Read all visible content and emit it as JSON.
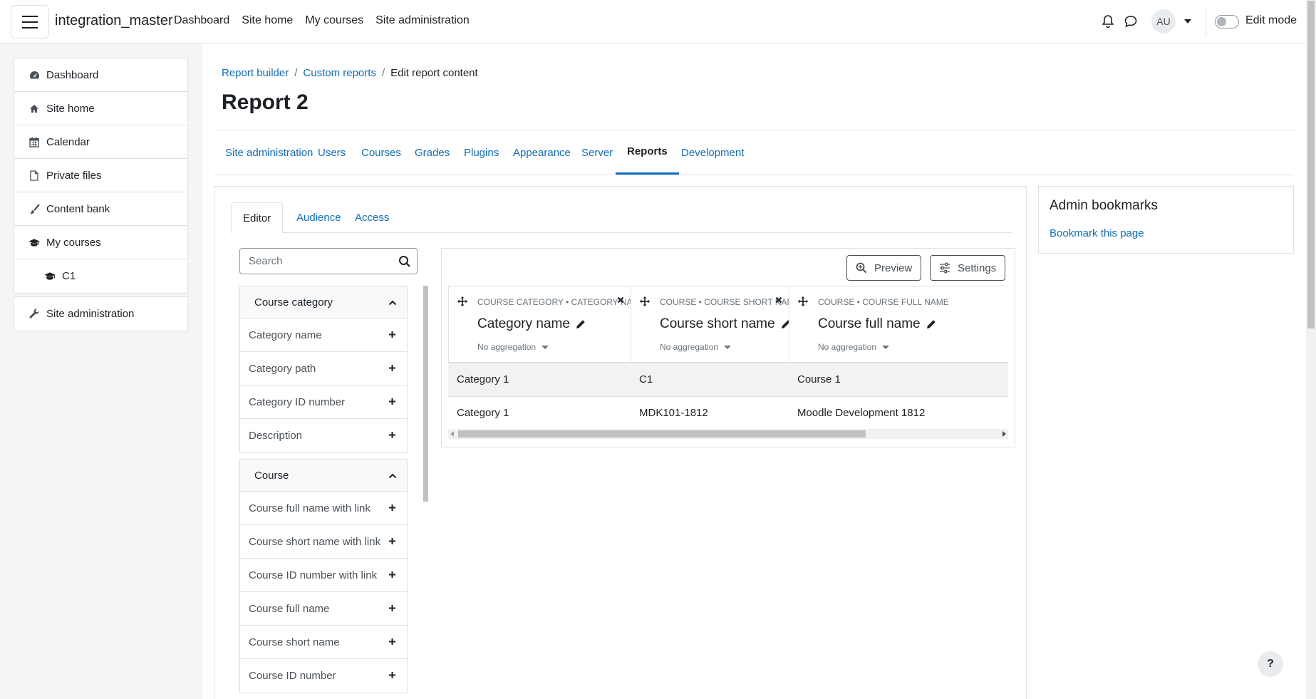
{
  "navbar": {
    "site_name": "integration_master",
    "links": [
      "Dashboard",
      "Site home",
      "My courses",
      "Site administration"
    ],
    "user_initials": "AU",
    "edit_mode_label": "Edit mode"
  },
  "drawer": {
    "items": [
      {
        "label": "Dashboard",
        "icon": "dashboard-icon"
      },
      {
        "label": "Site home",
        "icon": "home-icon"
      },
      {
        "label": "Calendar",
        "icon": "calendar-icon"
      },
      {
        "label": "Private files",
        "icon": "file-icon"
      },
      {
        "label": "Content bank",
        "icon": "paintbrush-icon"
      },
      {
        "label": "My courses",
        "icon": "graduation-cap-icon"
      },
      {
        "label": "C1",
        "icon": "graduation-cap-icon"
      }
    ],
    "admin": {
      "label": "Site administration",
      "icon": "wrench-icon"
    }
  },
  "breadcrumb": [
    "Report builder",
    "Custom reports",
    "Edit report content"
  ],
  "page_title": "Report 2",
  "secondary_nav": {
    "tabs": [
      "Site administration",
      "Users",
      "Courses",
      "Grades",
      "Plugins",
      "Appearance",
      "Server",
      "Reports",
      "Development"
    ],
    "active": "Reports"
  },
  "editor_tabs": {
    "tabs": [
      "Editor",
      "Audience",
      "Access"
    ],
    "active": "Editor"
  },
  "search": {
    "placeholder": "Search",
    "value": ""
  },
  "field_groups": [
    {
      "title": "Course category",
      "items": [
        "Category name",
        "Category path",
        "Category ID number",
        "Description"
      ]
    },
    {
      "title": "Course",
      "items": [
        "Course full name with link",
        "Course short name with link",
        "Course ID number with link",
        "Course full name",
        "Course short name",
        "Course ID number"
      ]
    }
  ],
  "report_buttons": {
    "preview": "Preview",
    "settings": "Settings"
  },
  "columns": [
    {
      "type": "Course category • Category name",
      "name": "Category name",
      "aggregation": "No aggregation"
    },
    {
      "type": "Course • Course short name",
      "name": "Course short name",
      "aggregation": "No aggregation"
    },
    {
      "type": "Course • Course full name",
      "name": "Course full name",
      "aggregation": "No aggregation"
    }
  ],
  "rows": [
    [
      "Category 1",
      "C1",
      "Course 1"
    ],
    [
      "Category 1",
      "MDK101-1812",
      "Moodle Development 1812"
    ]
  ],
  "bookmarks": {
    "title": "Admin bookmarks",
    "link": "Bookmark this page"
  },
  "help": {
    "label": "?"
  },
  "colors": {
    "link": "#0f6cbf",
    "text": "#1d2125",
    "border": "#dee2e6",
    "drawer_bg": "#f5f5f5"
  }
}
